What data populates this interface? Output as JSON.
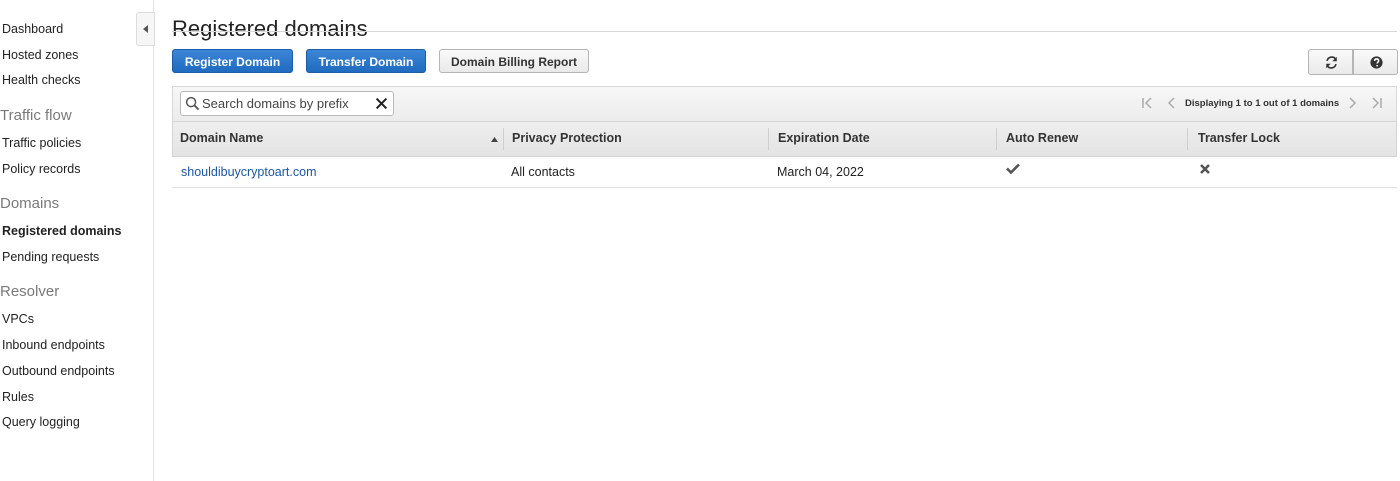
{
  "sidebar": {
    "items_top": [
      {
        "label": "Dashboard"
      },
      {
        "label": "Hosted zones"
      },
      {
        "label": "Health checks"
      }
    ],
    "section_traffic": "Traffic flow",
    "items_traffic": [
      {
        "label": "Traffic policies"
      },
      {
        "label": "Policy records"
      }
    ],
    "section_domains": "Domains",
    "items_domains": [
      {
        "label": "Registered domains",
        "active": true
      },
      {
        "label": "Pending requests"
      }
    ],
    "section_resolver": "Resolver",
    "items_resolver": [
      {
        "label": "VPCs"
      },
      {
        "label": "Inbound endpoints"
      },
      {
        "label": "Outbound endpoints"
      },
      {
        "label": "Rules"
      },
      {
        "label": "Query logging"
      }
    ]
  },
  "page": {
    "title": "Registered domains"
  },
  "toolbar": {
    "register_label": "Register Domain",
    "transfer_label": "Transfer Domain",
    "billing_label": "Domain Billing Report",
    "refresh_icon": "refresh-icon",
    "help_icon": "help-icon"
  },
  "search": {
    "placeholder": "Search domains by prefix",
    "value": ""
  },
  "pagination": {
    "text": "Displaying 1 to 1 out of 1 domains"
  },
  "table": {
    "columns": [
      "Domain Name",
      "Privacy Protection",
      "Expiration Date",
      "Auto Renew",
      "Transfer Lock"
    ],
    "sorted_column": "Domain Name",
    "rows": [
      {
        "domain": "shouldibuycryptoart.com",
        "privacy": "All contacts",
        "expiration": "March 04, 2022",
        "auto_renew": true,
        "transfer_lock": false
      }
    ]
  },
  "colors": {
    "primary_button": "#1f6bbf",
    "link": "#1b56a6",
    "section_header": "#7a7a7a"
  }
}
